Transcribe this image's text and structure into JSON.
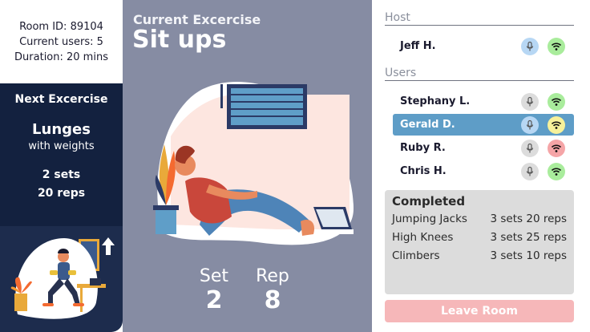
{
  "room": {
    "room_id": "Room ID: 89104",
    "current_users": "Current users: 5",
    "duration": "Duration: 20 mins"
  },
  "next_exercise": {
    "title": "Next Excercise",
    "name": "Lunges",
    "subtitle": "with weights",
    "sets": "2 sets",
    "reps": "20 reps"
  },
  "current_exercise": {
    "label": "Current Excercise",
    "name": "Sit ups",
    "set_label": "Set",
    "set_value": "2",
    "rep_label": "Rep",
    "rep_value": "8"
  },
  "participants": {
    "host_heading": "Host",
    "host": {
      "name": "Jeff H.",
      "mic": "mic-on",
      "signal": "wifi-good"
    },
    "users_heading": "Users",
    "users": [
      {
        "name": "Stephany L.",
        "mic": "mic-off",
        "signal": "wifi-good"
      },
      {
        "name": "Gerald D.",
        "mic": "mic-on",
        "signal": "wifi-mid",
        "selected": true
      },
      {
        "name": "Ruby R.",
        "mic": "mic-off",
        "signal": "wifi-bad"
      },
      {
        "name": "Chris H.",
        "mic": "mic-off",
        "signal": "wifi-good"
      }
    ]
  },
  "completed": {
    "title": "Completed",
    "items": [
      {
        "name": "Jumping Jacks",
        "detail": "3 sets 20 reps"
      },
      {
        "name": "High Knees",
        "detail": "3 sets 25 reps"
      },
      {
        "name": "Climbers",
        "detail": "3 sets 10 reps"
      }
    ]
  },
  "leave_button": "Leave Room",
  "colors": {
    "navy": "#13213f",
    "slate": "#868ca3",
    "selected_row": "#5e9dc7",
    "leave_button": "#f6b7b9",
    "signal_good": "#a9ec9c",
    "signal_mid": "#f7f19a",
    "signal_bad": "#f5a5a7"
  }
}
